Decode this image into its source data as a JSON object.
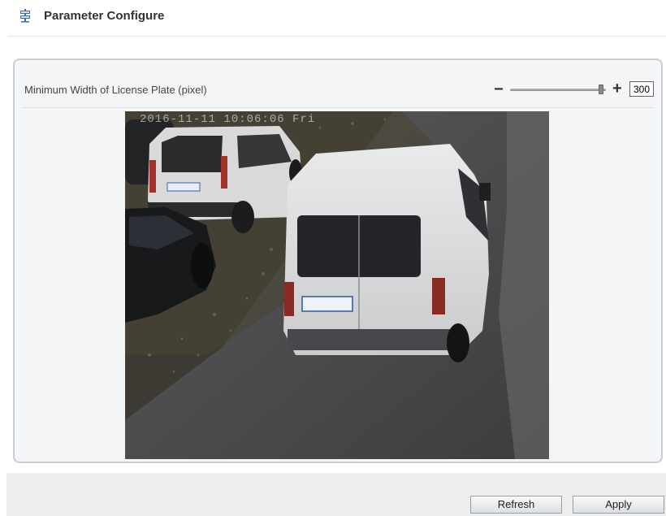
{
  "header": {
    "title": "Parameter Configure",
    "icon": "signpost-icon"
  },
  "settings": {
    "label": "Minimum Width of License Plate (pixel)",
    "minus_label": "−",
    "plus_label": "+",
    "value": "300",
    "slider_level": 0.97
  },
  "camera": {
    "osd_text": "2016-11-11 10:06:06 Fri",
    "description_hint": "camera"
  },
  "footer": {
    "refresh_label": "Refresh",
    "apply_label": "Apply"
  }
}
